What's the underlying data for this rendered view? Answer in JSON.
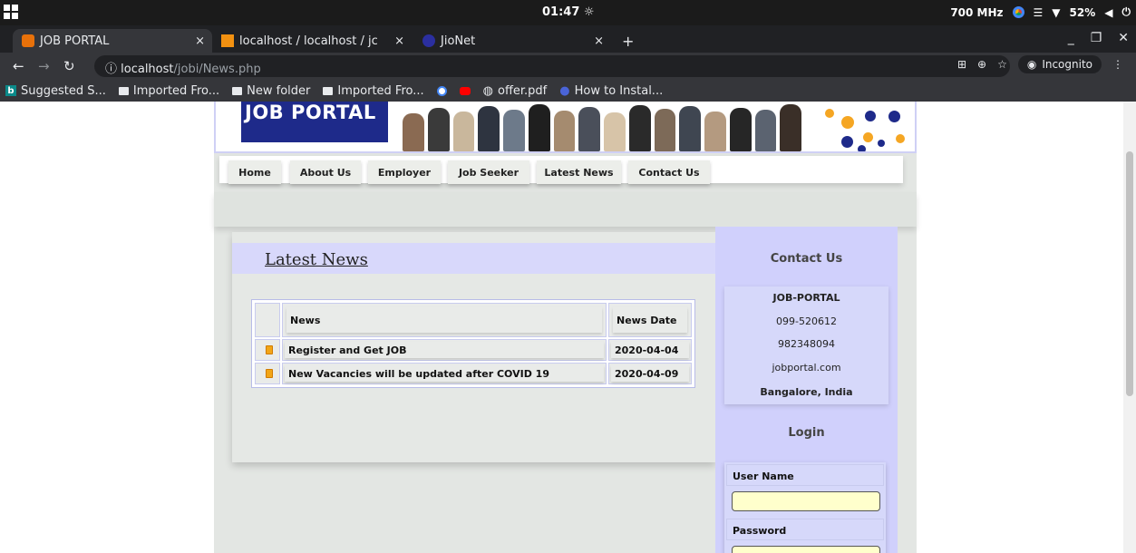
{
  "os": {
    "clock": "01:47",
    "cpu": "700 MHz",
    "battery": "52%"
  },
  "browser": {
    "tabs": [
      {
        "label": "JOB PORTAL",
        "close": "×"
      },
      {
        "label": "localhost / localhost / jc",
        "close": "×"
      },
      {
        "label": "JioNet",
        "close": "×"
      }
    ],
    "new_tab": "+",
    "url_host": "localhost",
    "url_path": "/jobi/News.php",
    "incognito_label": "Incognito",
    "bookmarks": [
      {
        "label": "Suggested S...",
        "icon": "bing-icon"
      },
      {
        "label": "Imported Fro...",
        "icon": "folder-icon"
      },
      {
        "label": "New folder",
        "icon": "folder-icon"
      },
      {
        "label": "Imported Fro...",
        "icon": "folder-icon"
      },
      {
        "label": "offer.pdf",
        "icon": "globe-icon"
      },
      {
        "label": "How to Instal...",
        "icon": "globe-icon"
      }
    ]
  },
  "site": {
    "logo_text": "JOB PORTAL",
    "menu": [
      "Home",
      "About Us",
      "Employer",
      "Job Seeker",
      "Latest News",
      "Contact Us"
    ],
    "news_heading": "Latest News",
    "table": {
      "headers": [
        "News",
        "News Date"
      ],
      "rows": [
        {
          "news": "Register and Get JOB",
          "date": "2020-04-04"
        },
        {
          "news": "New Vacancies will be updated after COVID 19",
          "date": "2020-04-09"
        }
      ]
    },
    "sidebar": {
      "contact_title": "Contact Us",
      "contact_lines": [
        "JOB-PORTAL",
        "099-520612",
        "982348094",
        "jobportal.com",
        "Bangalore, India"
      ],
      "login_title": "Login",
      "username_label": "User Name",
      "password_label": "Password"
    }
  },
  "colors": {
    "sidebar_bg": "#d0d0fc",
    "logo_bg": "#1e2a8a",
    "input_bg": "#ffffcc",
    "bullet": "#f2a516"
  }
}
